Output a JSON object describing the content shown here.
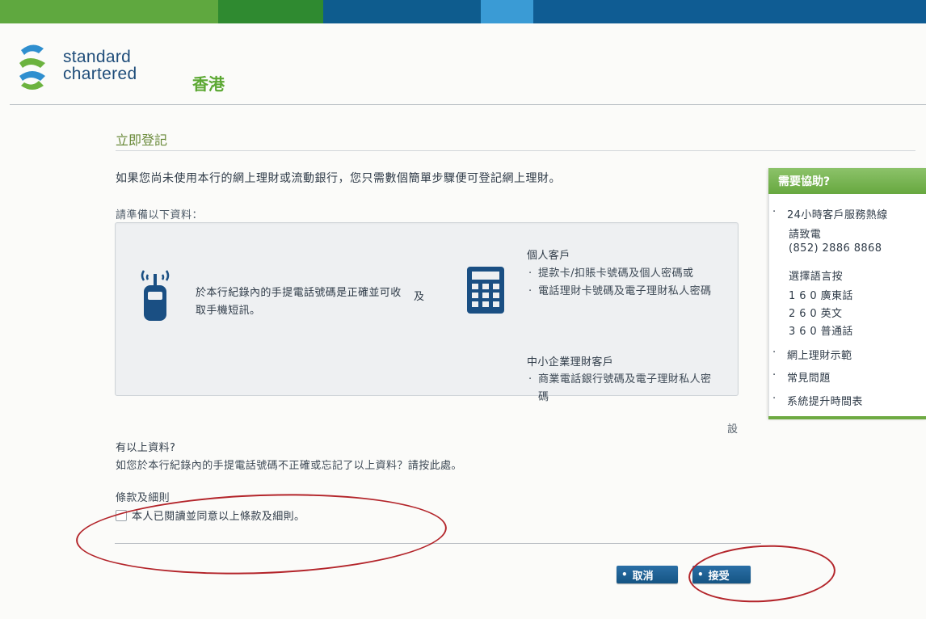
{
  "brand": {
    "line1": "standard",
    "line2": "chartered",
    "region": "香港",
    "colors": {
      "green": "#5fa83f",
      "blue": "#0f5c93"
    }
  },
  "page": {
    "title": "立即登記",
    "intro": "如果您尚未使用本行的網上理財或流動銀行，您只需數個簡單步驟便可登記網上理財。",
    "prepare_label": "請準備以下資料："
  },
  "info": {
    "phone_text": "於本行紀錄內的手提電話號碼是正確並可收取手機短訊。",
    "and": "及",
    "personal_title": "個人客戶",
    "personal_options": [
      "提款卡/扣賬卡號碼及個人密碼或",
      "電話理財卡號碼及電子理財私人密碼"
    ],
    "sme_title": "中小企業理財客戶",
    "sme_options": [
      "商業電話銀行號碼及電子理財私人密碼"
    ],
    "stray_char": "設"
  },
  "forgot": {
    "title": "有以上資料?",
    "body": "如您於本行紀錄內的手提電話號碼不正確或忘記了以上資料？請按此處。"
  },
  "terms": {
    "title": "條款及細則",
    "checkbox_label": "本人已閱讀並同意以上條款及細則。"
  },
  "buttons": {
    "cancel": "取消",
    "accept": "接受"
  },
  "help": {
    "title": "需要協助?",
    "hotline_title": "24小時客戶服務熱線",
    "call": "請致電",
    "phone": "(852) 2886 8868",
    "choose_lang": "選擇語言按",
    "lang_options": [
      "1 6 0 廣東話",
      "2 6 0 英文",
      "3 6 0 普通話"
    ],
    "links": [
      "網上理財示範",
      "常見問題",
      "系統提升時間表"
    ]
  }
}
